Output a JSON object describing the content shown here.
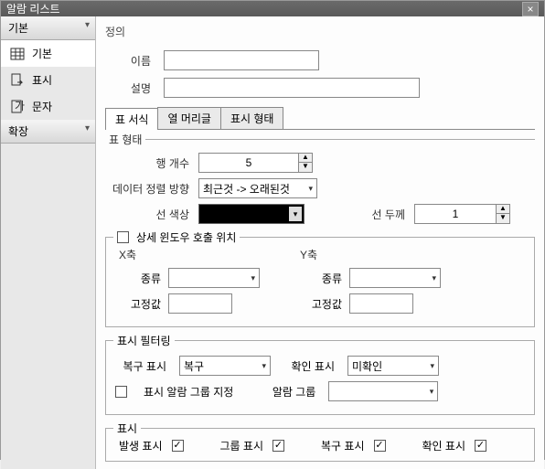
{
  "title": "알람 리스트",
  "sidebar": {
    "sections": [
      {
        "label": "기본",
        "items": [
          {
            "label": "기본"
          },
          {
            "label": "표시"
          },
          {
            "label": "문자"
          }
        ]
      },
      {
        "label": "확장"
      }
    ]
  },
  "definition": {
    "legend": "정의",
    "name_label": "이름",
    "name_value": "",
    "desc_label": "설명",
    "desc_value": ""
  },
  "tabs": [
    {
      "label": "표 서식"
    },
    {
      "label": "열 머리글"
    },
    {
      "label": "표시 형태"
    }
  ],
  "table_form": {
    "legend": "표 형태",
    "row_count_label": "행 개수",
    "row_count_value": "5",
    "sort_label": "데이터 정렬 방향",
    "sort_value": "최근것 -> 오래된것",
    "line_color_label": "선 색상",
    "line_color_value": "#000000",
    "line_width_label": "선 두께",
    "line_width_value": "1"
  },
  "detail_win": {
    "legend": "상세 윈도우 호출 위치",
    "x_label": "X축",
    "y_label": "Y축",
    "type_label": "종류",
    "fixed_label": "고정값",
    "x_type": "",
    "x_fixed": "",
    "y_type": "",
    "y_fixed": ""
  },
  "filter": {
    "legend": "표시 필터링",
    "recover_label": "복구 표시",
    "recover_value": "복구",
    "ack_label": "확인 표시",
    "ack_value": "미확인",
    "group_chk_label": "표시 알람 그룹 지정",
    "group_label": "알람 그룹",
    "group_value": ""
  },
  "display": {
    "legend": "표시",
    "occur_label": "발생 표시",
    "group_label": "그룹 표시",
    "recover_label": "복구 표시",
    "ack_label": "확인 표시"
  }
}
